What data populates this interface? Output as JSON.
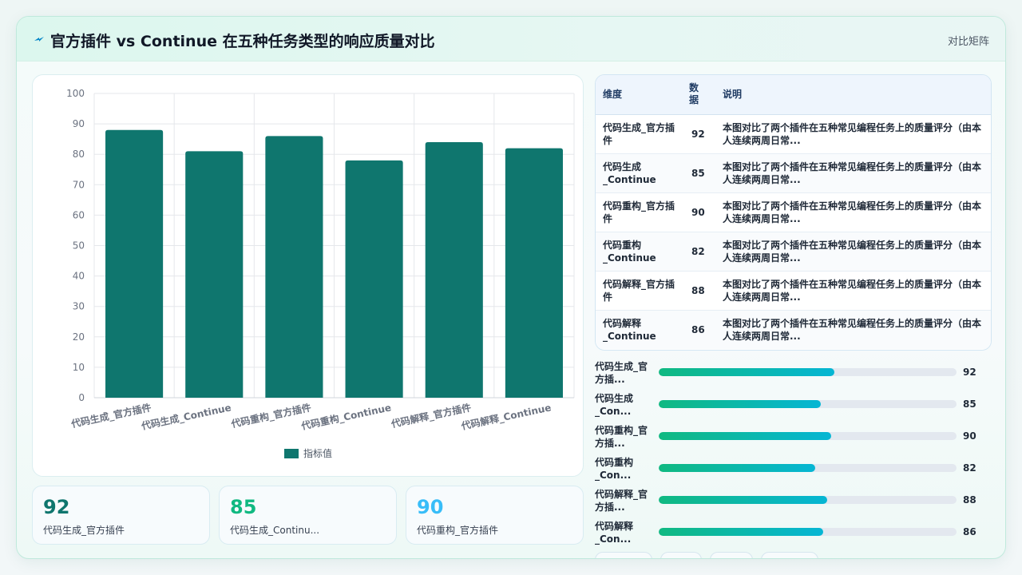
{
  "header": {
    "title": "官方插件 vs Continue 在五种任务类型的响应质量对比",
    "mode_label": "对比矩阵"
  },
  "colors": {
    "bar": "#0f766e",
    "kpi_1": "#0f766e",
    "kpi_2": "#10b981",
    "kpi_3": "#38bdf8"
  },
  "chart_data": {
    "type": "bar",
    "categories": [
      "代码生成_官方插件",
      "代码生成_Continue",
      "代码重构_官方插件",
      "代码重构_Continue",
      "代码解释_官方插件",
      "代码解释_Continue"
    ],
    "series": [
      {
        "name": "指标值",
        "values": [
          88,
          81,
          86,
          78,
          84,
          82
        ]
      }
    ],
    "ylim": [
      0,
      100
    ],
    "yticks": [
      0,
      10,
      20,
      30,
      40,
      50,
      60,
      70,
      80,
      90,
      100
    ],
    "grid": true,
    "legend_position": "bottom"
  },
  "kpis": [
    {
      "value": "92",
      "label": "代码生成_官方插件"
    },
    {
      "value": "85",
      "label": "代码生成_Continu..."
    },
    {
      "value": "90",
      "label": "代码重构_官方插件"
    }
  ],
  "table": {
    "headers": [
      "维度",
      "数据",
      "说明"
    ],
    "rows": [
      [
        "代码生成_官方插件",
        "92",
        "本图对比了两个插件在五种常见编程任务上的质量评分（由本人连续两周日常..."
      ],
      [
        "代码生成_Continue",
        "85",
        "本图对比了两个插件在五种常见编程任务上的质量评分（由本人连续两周日常..."
      ],
      [
        "代码重构_官方插件",
        "90",
        "本图对比了两个插件在五种常见编程任务上的质量评分（由本人连续两周日常..."
      ],
      [
        "代码重构_Continue",
        "82",
        "本图对比了两个插件在五种常见编程任务上的质量评分（由本人连续两周日常..."
      ],
      [
        "代码解释_官方插件",
        "88",
        "本图对比了两个插件在五种常见编程任务上的质量评分（由本人连续两周日常..."
      ],
      [
        "代码解释_Continue",
        "86",
        "本图对比了两个插件在五种常见编程任务上的质量评分（由本人连续两周日常..."
      ]
    ]
  },
  "progress": [
    {
      "label": "代码生成_官方插...",
      "value": 92,
      "fraction": 0.59
    },
    {
      "label": "代码生成_Con...",
      "value": 85,
      "fraction": 0.545
    },
    {
      "label": "代码重构_官方插...",
      "value": 90,
      "fraction": 0.578
    },
    {
      "label": "代码重构_Con...",
      "value": 82,
      "fraction": 0.525
    },
    {
      "label": "代码解释_官方插...",
      "value": 88,
      "fraction": 0.565
    },
    {
      "label": "代码解释_Con...",
      "value": 86,
      "fraction": 0.551
    }
  ]
}
